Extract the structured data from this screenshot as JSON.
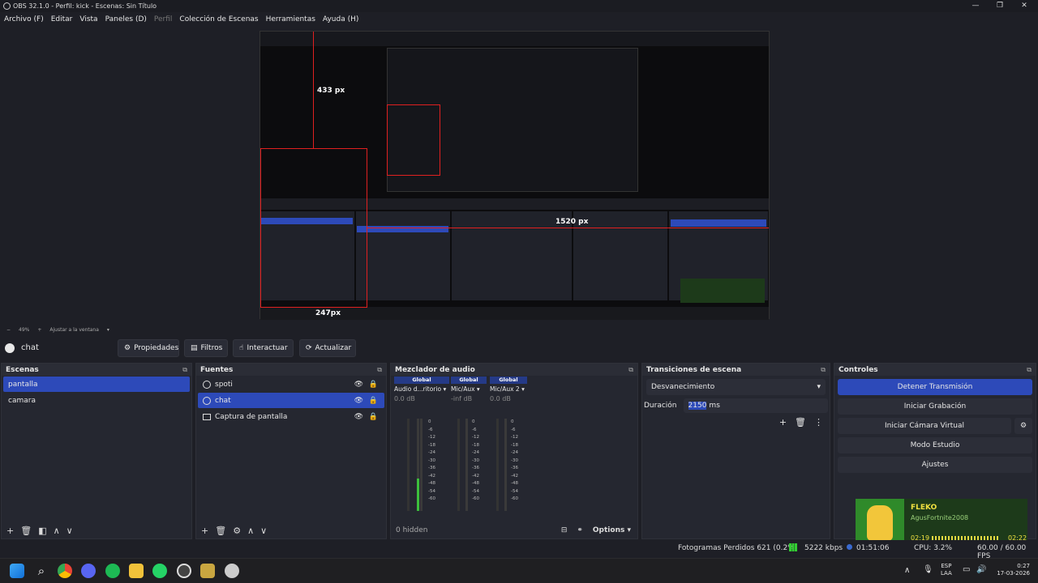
{
  "window": {
    "title": "OBS 32.1.0 - Perfil: kick - Escenas: Sin Título",
    "min": "—",
    "max": "❐",
    "close": "✕"
  },
  "menu": [
    {
      "label": "Archivo (F)"
    },
    {
      "label": "Editar"
    },
    {
      "label": "Vista"
    },
    {
      "label": "Paneles (D)"
    },
    {
      "label": "Perfil",
      "disabled": true
    },
    {
      "label": "Colección de Escenas"
    },
    {
      "label": "Herramientas"
    },
    {
      "label": "Ayuda (H)"
    }
  ],
  "preview": {
    "measure_v": "433 px",
    "measure_h1": "1520 px",
    "measure_h2": "247px",
    "zoom": "49%",
    "fit": "Ajustar a la ventana"
  },
  "context": {
    "source": "chat",
    "properties": "Propiedades",
    "filters": "Filtros",
    "interact": "Interactuar",
    "refresh": "Actualizar"
  },
  "scenes": {
    "title": "Escenas",
    "items": [
      {
        "label": "pantalla",
        "selected": true
      },
      {
        "label": "camara",
        "selected": false
      }
    ]
  },
  "sources": {
    "title": "Fuentes",
    "items": [
      {
        "label": "spoti",
        "icon": "browser-icon"
      },
      {
        "label": "chat",
        "icon": "browser-icon",
        "selected": true
      },
      {
        "label": "Captura de pantalla",
        "icon": "monitor-icon"
      }
    ]
  },
  "mixer": {
    "title": "Mezclador de audio",
    "hidden": "0 hidden",
    "options": "Options",
    "channels": [
      {
        "scope": "Global",
        "name": "Audio d...ritorio",
        "db": "0.0 dB",
        "level": 0.35
      },
      {
        "scope": "Global",
        "name": "Mic/Aux",
        "db": "-inf dB",
        "level": 0
      },
      {
        "scope": "Global",
        "name": "Mic/Aux 2",
        "db": "0.0 dB",
        "level": 0
      }
    ],
    "scale": [
      "0",
      "-6",
      "-12",
      "-18",
      "-24",
      "-30",
      "-36",
      "-42",
      "-48",
      "-54",
      "-60"
    ]
  },
  "transitions": {
    "title": "Transiciones de escena",
    "selected": "Desvanecimiento",
    "duration_label": "Duración",
    "duration_value": "2150",
    "duration_unit": "ms"
  },
  "controls": {
    "title": "Controles",
    "stop_stream": "Detener Transmisión",
    "start_recording": "Iniciar Grabación",
    "start_virtual_cam": "Iniciar Cámara Virtual",
    "studio_mode": "Modo Estudio",
    "settings": "Ajustes"
  },
  "overlay": {
    "name": "FLEKO",
    "user": "AgusFortnite2008",
    "t1": "02:19",
    "t2": "02:22"
  },
  "status": {
    "dropped": "Fotogramas Perdidos 621 (0.2%)",
    "kbps": "5222 kbps",
    "time": "01:51:06",
    "cpu": "CPU: 3.2%",
    "fps": "60.00 / 60.00 FPS"
  },
  "taskbar": {
    "lang": "ESP",
    "layout": "LAA",
    "time": "0:27",
    "date": "17-03-2026"
  },
  "colors": {
    "accent": "#2d4ab9",
    "panel": "#252730",
    "bg": "#1e1f26"
  }
}
